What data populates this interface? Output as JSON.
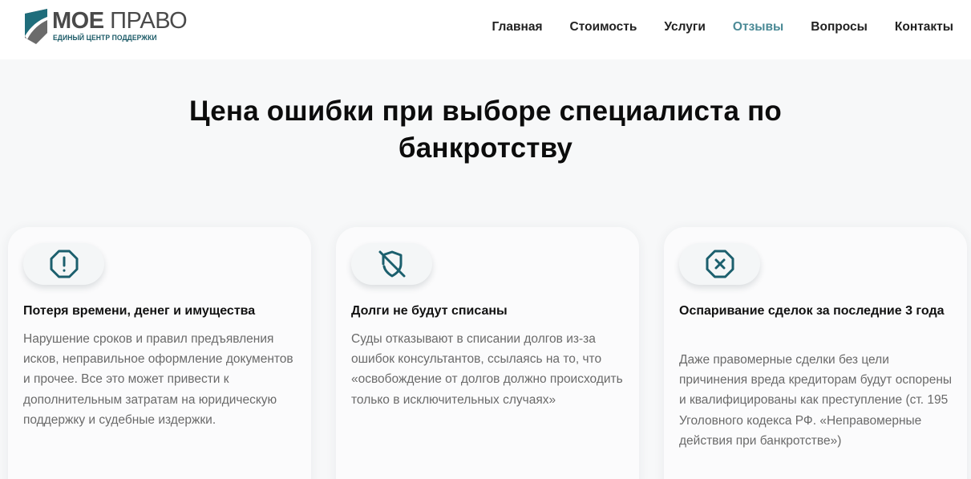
{
  "header": {
    "logo": {
      "title_bold": "МОЕ",
      "title_rest": " ПРАВО",
      "subtitle": "ЕДИНЫЙ ЦЕНТР ПОДДЕРЖКИ"
    },
    "nav": [
      {
        "label": "Главная",
        "active": false
      },
      {
        "label": "Стоимость",
        "active": false
      },
      {
        "label": "Услуги",
        "active": false
      },
      {
        "label": "Отзывы",
        "active": true
      },
      {
        "label": "Вопросы",
        "active": false
      },
      {
        "label": "Контакты",
        "active": false
      }
    ]
  },
  "section": {
    "title_line1": "Цена ошибки при выборе специалиста по",
    "title_line2": "банкротству"
  },
  "cards": [
    {
      "icon": "alert-octagon-icon",
      "title": "Потеря времени, денег и имущества",
      "text": "Нарушение сроков и правил предъявления исков, неправильное оформление документов и прочее. Все это может привести к дополнительным затратам на юридическую поддержку и судебные издержки."
    },
    {
      "icon": "shield-off-icon",
      "title": "Долги не будут списаны",
      "text": "Суды отказывают в списании долгов из-за ошибок консультантов, ссылаясь на то, что «освобождение от долгов должно происходить только в исключительных случаях»"
    },
    {
      "icon": "x-octagon-icon",
      "title": "Оспаривание сделок за последние 3 года",
      "text": "Даже правомерные сделки без цели причинения вреда кредиторам будут оспорены и квалифицированы как преступление (ст. 195 Уголовного кодекса РФ. «Неправомерные действия при банкротстве»)"
    }
  ],
  "colors": {
    "accent": "#1b5f6d",
    "nav_active": "#4b8a96",
    "background": "#f7f8f9"
  }
}
